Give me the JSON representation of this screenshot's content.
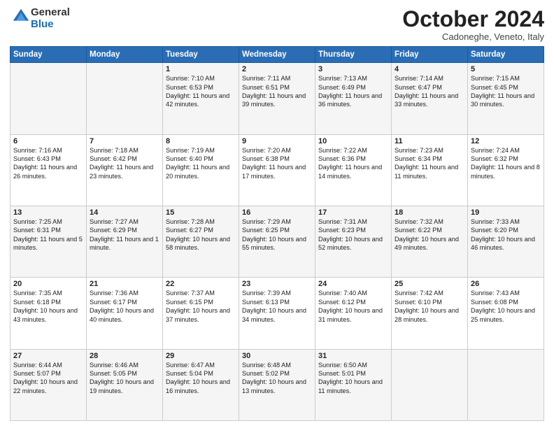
{
  "header": {
    "logo_line1": "General",
    "logo_line2": "Blue",
    "month": "October 2024",
    "location": "Cadoneghe, Veneto, Italy"
  },
  "weekdays": [
    "Sunday",
    "Monday",
    "Tuesday",
    "Wednesday",
    "Thursday",
    "Friday",
    "Saturday"
  ],
  "weeks": [
    [
      {
        "day": "",
        "info": ""
      },
      {
        "day": "",
        "info": ""
      },
      {
        "day": "1",
        "info": "Sunrise: 7:10 AM\nSunset: 6:53 PM\nDaylight: 11 hours and 42 minutes."
      },
      {
        "day": "2",
        "info": "Sunrise: 7:11 AM\nSunset: 6:51 PM\nDaylight: 11 hours and 39 minutes."
      },
      {
        "day": "3",
        "info": "Sunrise: 7:13 AM\nSunset: 6:49 PM\nDaylight: 11 hours and 36 minutes."
      },
      {
        "day": "4",
        "info": "Sunrise: 7:14 AM\nSunset: 6:47 PM\nDaylight: 11 hours and 33 minutes."
      },
      {
        "day": "5",
        "info": "Sunrise: 7:15 AM\nSunset: 6:45 PM\nDaylight: 11 hours and 30 minutes."
      }
    ],
    [
      {
        "day": "6",
        "info": "Sunrise: 7:16 AM\nSunset: 6:43 PM\nDaylight: 11 hours and 26 minutes."
      },
      {
        "day": "7",
        "info": "Sunrise: 7:18 AM\nSunset: 6:42 PM\nDaylight: 11 hours and 23 minutes."
      },
      {
        "day": "8",
        "info": "Sunrise: 7:19 AM\nSunset: 6:40 PM\nDaylight: 11 hours and 20 minutes."
      },
      {
        "day": "9",
        "info": "Sunrise: 7:20 AM\nSunset: 6:38 PM\nDaylight: 11 hours and 17 minutes."
      },
      {
        "day": "10",
        "info": "Sunrise: 7:22 AM\nSunset: 6:36 PM\nDaylight: 11 hours and 14 minutes."
      },
      {
        "day": "11",
        "info": "Sunrise: 7:23 AM\nSunset: 6:34 PM\nDaylight: 11 hours and 11 minutes."
      },
      {
        "day": "12",
        "info": "Sunrise: 7:24 AM\nSunset: 6:32 PM\nDaylight: 11 hours and 8 minutes."
      }
    ],
    [
      {
        "day": "13",
        "info": "Sunrise: 7:25 AM\nSunset: 6:31 PM\nDaylight: 11 hours and 5 minutes."
      },
      {
        "day": "14",
        "info": "Sunrise: 7:27 AM\nSunset: 6:29 PM\nDaylight: 11 hours and 1 minute."
      },
      {
        "day": "15",
        "info": "Sunrise: 7:28 AM\nSunset: 6:27 PM\nDaylight: 10 hours and 58 minutes."
      },
      {
        "day": "16",
        "info": "Sunrise: 7:29 AM\nSunset: 6:25 PM\nDaylight: 10 hours and 55 minutes."
      },
      {
        "day": "17",
        "info": "Sunrise: 7:31 AM\nSunset: 6:23 PM\nDaylight: 10 hours and 52 minutes."
      },
      {
        "day": "18",
        "info": "Sunrise: 7:32 AM\nSunset: 6:22 PM\nDaylight: 10 hours and 49 minutes."
      },
      {
        "day": "19",
        "info": "Sunrise: 7:33 AM\nSunset: 6:20 PM\nDaylight: 10 hours and 46 minutes."
      }
    ],
    [
      {
        "day": "20",
        "info": "Sunrise: 7:35 AM\nSunset: 6:18 PM\nDaylight: 10 hours and 43 minutes."
      },
      {
        "day": "21",
        "info": "Sunrise: 7:36 AM\nSunset: 6:17 PM\nDaylight: 10 hours and 40 minutes."
      },
      {
        "day": "22",
        "info": "Sunrise: 7:37 AM\nSunset: 6:15 PM\nDaylight: 10 hours and 37 minutes."
      },
      {
        "day": "23",
        "info": "Sunrise: 7:39 AM\nSunset: 6:13 PM\nDaylight: 10 hours and 34 minutes."
      },
      {
        "day": "24",
        "info": "Sunrise: 7:40 AM\nSunset: 6:12 PM\nDaylight: 10 hours and 31 minutes."
      },
      {
        "day": "25",
        "info": "Sunrise: 7:42 AM\nSunset: 6:10 PM\nDaylight: 10 hours and 28 minutes."
      },
      {
        "day": "26",
        "info": "Sunrise: 7:43 AM\nSunset: 6:08 PM\nDaylight: 10 hours and 25 minutes."
      }
    ],
    [
      {
        "day": "27",
        "info": "Sunrise: 6:44 AM\nSunset: 5:07 PM\nDaylight: 10 hours and 22 minutes."
      },
      {
        "day": "28",
        "info": "Sunrise: 6:46 AM\nSunset: 5:05 PM\nDaylight: 10 hours and 19 minutes."
      },
      {
        "day": "29",
        "info": "Sunrise: 6:47 AM\nSunset: 5:04 PM\nDaylight: 10 hours and 16 minutes."
      },
      {
        "day": "30",
        "info": "Sunrise: 6:48 AM\nSunset: 5:02 PM\nDaylight: 10 hours and 13 minutes."
      },
      {
        "day": "31",
        "info": "Sunrise: 6:50 AM\nSunset: 5:01 PM\nDaylight: 10 hours and 11 minutes."
      },
      {
        "day": "",
        "info": ""
      },
      {
        "day": "",
        "info": ""
      }
    ]
  ]
}
